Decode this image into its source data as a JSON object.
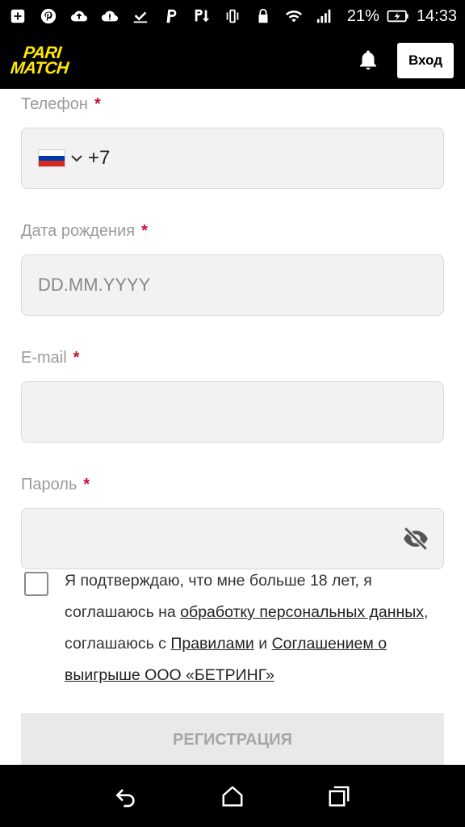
{
  "status_bar": {
    "battery": "21%",
    "time": "14:33",
    "icons": [
      "add-box-icon",
      "pinterest-icon",
      "cloud-upload-icon",
      "cloud-alert-icon",
      "check-download-icon",
      "p-icon",
      "p-down-icon",
      "vibrate-icon",
      "lock-icon",
      "wifi-icon",
      "signal-icon",
      "battery-charging-icon"
    ]
  },
  "header": {
    "logo_line1": "PARI",
    "logo_line2": "MATCH",
    "login_label": "Вход",
    "brand_color": "#ffe900"
  },
  "form": {
    "phone": {
      "label": "Телефон",
      "required": "*",
      "code": "+7"
    },
    "birth": {
      "label": "Дата рождения",
      "required": "*",
      "placeholder": "DD.MM.YYYY"
    },
    "email": {
      "label": "E-mail",
      "required": "*",
      "value": ""
    },
    "password": {
      "label": "Пароль",
      "required": "*",
      "value": ""
    }
  },
  "consent": {
    "t1": "Я подтверждаю, что мне больше 18 лет, я соглашаюсь на ",
    "link1": "обработку персональных данных",
    "t2": ", соглашаюсь с ",
    "link2": "Правилами",
    "t3": " и ",
    "link3": "Соглашением о выигрыше ООО «БЕТРИНГ»"
  },
  "register_label": "РЕГИСТРАЦИЯ"
}
